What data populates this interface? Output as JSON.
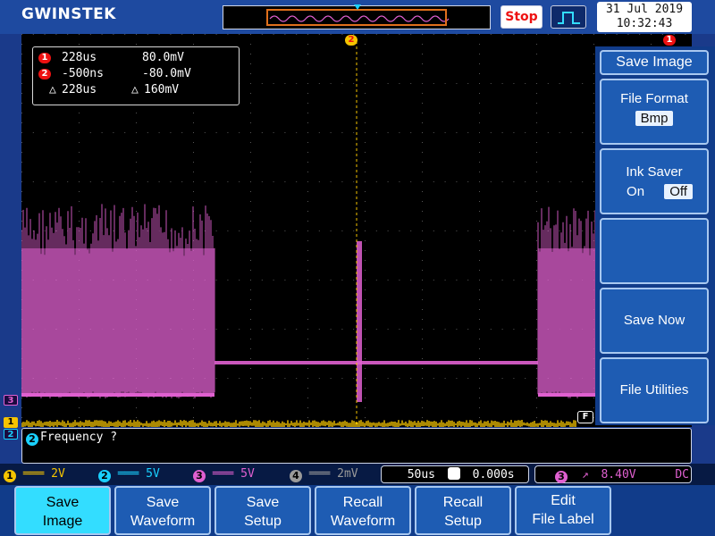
{
  "header": {
    "brand": "GWINSTEK",
    "run_state": "Stop",
    "date": "31 Jul 2019",
    "time": "10:32:43"
  },
  "cursors": {
    "row1": {
      "marker": "1",
      "time": "228us",
      "voltage": "80.0mV"
    },
    "row2": {
      "marker": "2",
      "time": "-500ns",
      "voltage": "-80.0mV"
    },
    "delta": {
      "time": "228us",
      "voltage": "160mV"
    }
  },
  "channel_markers": {
    "ch3": "3",
    "ch1": "1",
    "ch2": "2",
    "trigger": "2",
    "right_edge": "1",
    "math": "F"
  },
  "side_menu": {
    "title": "Save Image",
    "file_format_label": "File Format",
    "file_format_value": "Bmp",
    "ink_saver_label": "Ink Saver",
    "ink_saver_on": "On",
    "ink_saver_off": "Off",
    "save_now": "Save Now",
    "file_utilities": "File Utilities"
  },
  "message": {
    "marker": "2",
    "text": "Frequency ?"
  },
  "status_bar": {
    "ch1": {
      "num": "1",
      "scale": "2V"
    },
    "ch2": {
      "num": "2",
      "scale": "5V"
    },
    "ch3": {
      "num": "3",
      "scale": "5V"
    },
    "ch4": {
      "num": "4",
      "scale": "2mV"
    },
    "timebase": "50us",
    "position": "0.000s",
    "trigger_source": "3",
    "trigger_level": "8.40V",
    "coupling": "DC"
  },
  "bottom_menu": [
    {
      "line1": "Save",
      "line2": "Image"
    },
    {
      "line1": "Save",
      "line2": "Waveform"
    },
    {
      "line1": "Save",
      "line2": "Setup"
    },
    {
      "line1": "Recall",
      "line2": "Waveform"
    },
    {
      "line1": "Recall",
      "line2": "Setup"
    },
    {
      "line1": "Edit",
      "line2": "File Label"
    }
  ],
  "colors": {
    "ch1": "#f5c400",
    "ch2": "#19d0ff",
    "ch3": "#e060d0",
    "ch4": "#9a9a9a",
    "cursor_line": "#f5c400",
    "active_button": "#33ddff",
    "stop": "#e11111"
  }
}
